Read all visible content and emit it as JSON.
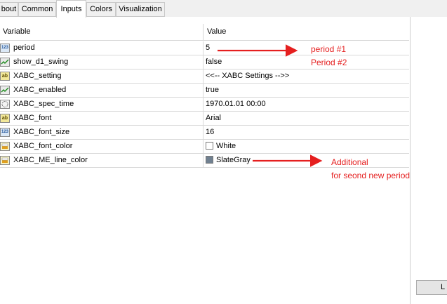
{
  "tabs": [
    {
      "label": "bout"
    },
    {
      "label": "Common"
    },
    {
      "label": "Inputs"
    },
    {
      "label": "Colors"
    },
    {
      "label": "Visualization"
    }
  ],
  "grid": {
    "headers": {
      "variable": "Variable",
      "value": "Value"
    },
    "rows": [
      {
        "icon": "number-icon",
        "name": "period",
        "value": "5"
      },
      {
        "icon": "boolean-icon",
        "name": "show_d1_swing",
        "value": "false"
      },
      {
        "icon": "string-icon",
        "name": "XABC_setting",
        "value": "<<-- XABC Settings -->>"
      },
      {
        "icon": "boolean-icon",
        "name": "XABC_enabled",
        "value": "true"
      },
      {
        "icon": "datetime-icon",
        "name": "XABC_spec_time",
        "value": "1970.01.01 00:00"
      },
      {
        "icon": "string-icon",
        "name": "XABC_font",
        "value": "Arial"
      },
      {
        "icon": "number-icon",
        "name": "XABC_font_size",
        "value": "16"
      },
      {
        "icon": "color-icon",
        "name": "XABC_font_color",
        "value": "White",
        "swatch": "#ffffff"
      },
      {
        "icon": "color-icon",
        "name": "XABC_ME_line_color",
        "value": "SlateGray",
        "swatch": "#708090"
      }
    ]
  },
  "annotations": {
    "period1": "period #1",
    "period2": "Period #2",
    "additional_line1": "Additional",
    "additional_line2": "for seond new period",
    "color": "#e51f1f"
  },
  "side_button": {
    "label": "L"
  },
  "icons": {
    "number": "123",
    "string": "ab"
  }
}
